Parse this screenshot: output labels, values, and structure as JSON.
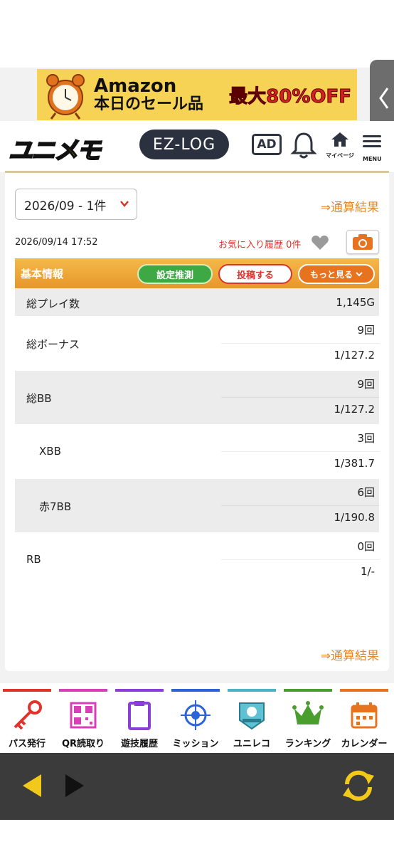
{
  "banner": {
    "line1": "Amazon",
    "line2": "本日のセール品",
    "sale": "最大80%OFF"
  },
  "header": {
    "logo": "ユニメモ",
    "ezlog": "EZ-LOG",
    "ad": "AD",
    "mypage_label": "マイページ",
    "menu_label": "MENU"
  },
  "card": {
    "period_select": "2026/09 - 1件",
    "total_link": "⇒通算結果",
    "datetime": "2026/09/14 17:52",
    "favorites": "お気に入り履歴 0件",
    "section": {
      "title": "基本情報",
      "setting_btn": "設定推測",
      "post_btn": "投稿する",
      "more_btn": "もっと見る"
    },
    "stats": [
      {
        "label": "総プレイ数",
        "v1": "1,145G",
        "v2": null,
        "shade": "gray",
        "indent": false
      },
      {
        "label": "総ボーナス",
        "v1": "9回",
        "v2": "1/127.2",
        "shade": "white",
        "indent": false
      },
      {
        "label": "総BB",
        "v1": "9回",
        "v2": "1/127.2",
        "shade": "gray",
        "indent": false
      },
      {
        "label": "XBB",
        "v1": "3回",
        "v2": "1/381.7",
        "shade": "white",
        "indent": true
      },
      {
        "label": "赤7BB",
        "v1": "6回",
        "v2": "1/190.8",
        "shade": "gray",
        "indent": true
      },
      {
        "label": "RB",
        "v1": "0回",
        "v2": "1/-",
        "shade": "white",
        "indent": false
      }
    ]
  },
  "bottom_nav": [
    {
      "label": "パス発行",
      "icon": "key-icon",
      "color": "#e0332b"
    },
    {
      "label": "QR読取り",
      "icon": "qr-code-icon",
      "color": "#d83fb8"
    },
    {
      "label": "遊技履歴",
      "icon": "clipboard-icon",
      "color": "#8b3fd8"
    },
    {
      "label": "ミッション",
      "icon": "target-icon",
      "color": "#2c64d8"
    },
    {
      "label": "ユニレコ",
      "icon": "unireco-badge-icon",
      "color": "#4ab3c8"
    },
    {
      "label": "ランキング",
      "icon": "crown-icon",
      "color": "#4a9e2e"
    },
    {
      "label": "カレンダー",
      "icon": "calendar-icon",
      "color": "#e8731f"
    }
  ],
  "colors": {
    "accent_orange": "#e8962a",
    "link_orange": "#e6882a",
    "red": "#d9352b",
    "green": "#3ea844"
  }
}
